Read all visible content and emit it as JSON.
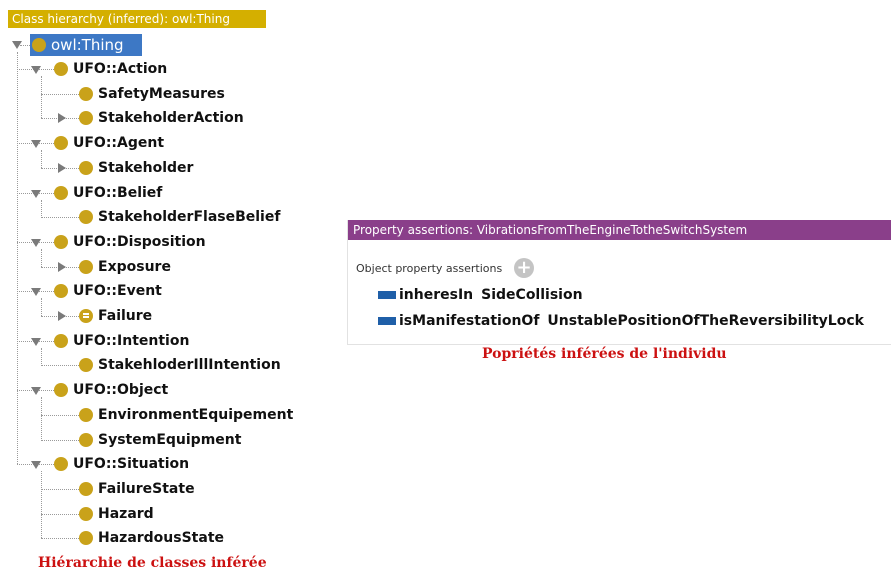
{
  "hierarchy": {
    "header": "Class hierarchy (inferred): owl:Thing",
    "root": "owl:Thing",
    "nodes": [
      {
        "label": "UFO::Action",
        "level": 1,
        "toggle": "open",
        "icon": "class-icon"
      },
      {
        "label": "SafetyMeasures",
        "level": 2,
        "toggle": "none",
        "icon": "class-icon"
      },
      {
        "label": "StakeholderAction",
        "level": 2,
        "toggle": "closed",
        "icon": "class-icon"
      },
      {
        "label": "UFO::Agent",
        "level": 1,
        "toggle": "open",
        "icon": "class-icon"
      },
      {
        "label": "Stakeholder",
        "level": 2,
        "toggle": "closed",
        "icon": "class-icon"
      },
      {
        "label": "UFO::Belief",
        "level": 1,
        "toggle": "open",
        "icon": "class-icon"
      },
      {
        "label": "StakeholderFlaseBelief",
        "level": 2,
        "toggle": "none",
        "icon": "class-icon"
      },
      {
        "label": "UFO::Disposition",
        "level": 1,
        "toggle": "open",
        "icon": "class-icon"
      },
      {
        "label": "Exposure",
        "level": 2,
        "toggle": "closed",
        "icon": "class-icon"
      },
      {
        "label": "UFO::Event",
        "level": 1,
        "toggle": "open",
        "icon": "class-icon"
      },
      {
        "label": "Failure",
        "level": 2,
        "toggle": "closed",
        "icon": "equivalent-class-icon"
      },
      {
        "label": "UFO::Intention",
        "level": 1,
        "toggle": "open",
        "icon": "class-icon"
      },
      {
        "label": "StakehloderIllIntention",
        "level": 2,
        "toggle": "none",
        "icon": "class-icon"
      },
      {
        "label": "UFO::Object",
        "level": 1,
        "toggle": "open",
        "icon": "class-icon"
      },
      {
        "label": "EnvironmentEquipement",
        "level": 2,
        "toggle": "none",
        "icon": "class-icon"
      },
      {
        "label": "SystemEquipment",
        "level": 2,
        "toggle": "none",
        "icon": "class-icon"
      },
      {
        "label": "UFO::Situation",
        "level": 1,
        "toggle": "open",
        "icon": "class-icon"
      },
      {
        "label": "FailureState",
        "level": 2,
        "toggle": "none",
        "icon": "class-icon"
      },
      {
        "label": "Hazard",
        "level": 2,
        "toggle": "none",
        "icon": "class-icon"
      },
      {
        "label": "HazardousState",
        "level": 2,
        "toggle": "none",
        "icon": "class-icon"
      }
    ],
    "caption": "Hiérarchie de classes inférée"
  },
  "properties": {
    "header": "Property assertions: VibrationsFromTheEngineTotheSwitchSystem",
    "section_label": "Object property assertions",
    "add_symbol": "+",
    "assertions": [
      {
        "property": "inheresIn",
        "value": "SideCollision"
      },
      {
        "property": "isManifestationOf",
        "value": "UnstablePositionOfTheReversibilityLock"
      }
    ],
    "caption": "Popriétés inférées de l'individu"
  },
  "colors": {
    "hierarchy_header": "#d4af00",
    "property_header": "#8a3f8a",
    "selection": "#3d78c5",
    "class_icon": "#c9a21a",
    "property_swatch": "#1f5fa8",
    "caption": "#cc1111"
  }
}
